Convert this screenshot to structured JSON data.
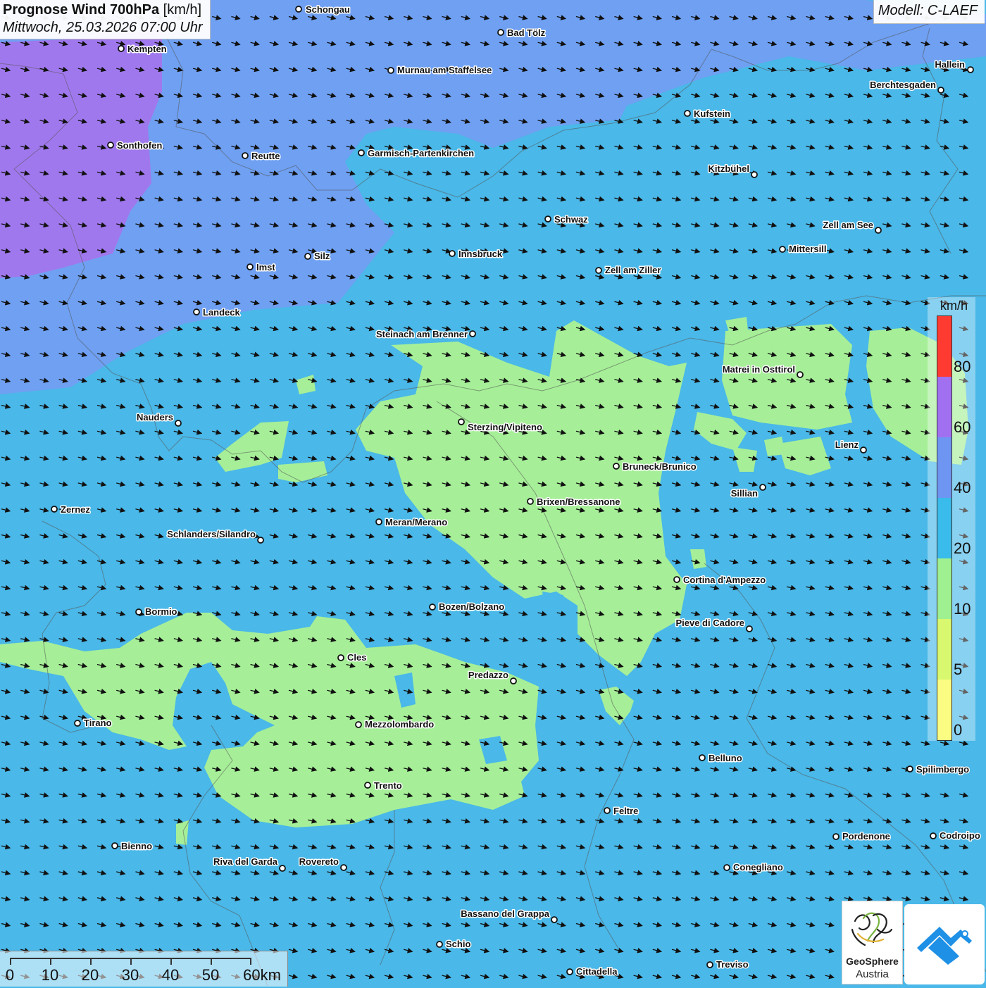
{
  "header": {
    "title_bold": "Prognose Wind 700hPa",
    "title_unit": "[km/h]",
    "subtitle": "Mittwoch, 25.03.2026 07:00 Uhr",
    "model": "Modell: C-LAEF"
  },
  "legend": {
    "unit": "km/h",
    "ticks": [
      "80",
      "60",
      "40",
      "20",
      "10",
      "5",
      "0"
    ],
    "colors": [
      "#ff3a30",
      "#a070f0",
      "#6f95f2",
      "#39bbeb",
      "#9ef090",
      "#d8f870",
      "#fbfc82"
    ]
  },
  "scalebar": {
    "labels": [
      "0",
      "10",
      "20",
      "30",
      "40",
      "50",
      "60km"
    ]
  },
  "logos": {
    "geosphere_name": "GeoSphere",
    "geosphere_sub": "Austria"
  },
  "map": {
    "field_colors": {
      "purple": "#a078ee",
      "blue": "#6fa0f2",
      "cyan": "#4ab8e8",
      "green": "#a6ef98"
    },
    "wind_direction": "west-northwest",
    "cities": [
      "Schongau",
      "Bad Tölz",
      "Kempten",
      "Murnau am Staffelsee",
      "Hallein",
      "Berchtesgaden",
      "Kufstein",
      "Sonthofen",
      "Reutte",
      "Garmisch-Partenkirchen",
      "Kitzbühel",
      "Schwaz",
      "Zell am See",
      "Mittersill",
      "Imst",
      "Silz",
      "Innsbruck",
      "Zell am Ziller",
      "Landeck",
      "Steinach am Brenner",
      "Matrei in Osttirol",
      "Nauders",
      "Sterzing/Vipiteno",
      "Lienz",
      "Bruneck/Brunico",
      "Sillian",
      "Brixen/Bressanone",
      "Zernez",
      "Meran/Merano",
      "Schlanders/Silandro",
      "Cortina d'Ampezzo",
      "Bozen/Bolzano",
      "Bormio",
      "Pieve di Cadore",
      "Cles",
      "Predazzo",
      "Tirano",
      "Mezzolombardo",
      "Belluno",
      "Spilimbergo",
      "Trento",
      "Feltre",
      "Bienno",
      "Pordenone",
      "Codroipo",
      "Riva del Garda",
      "Rovereto",
      "Conegliano",
      "Bassano del Grappa",
      "Schio",
      "Treviso",
      "Cittadella"
    ]
  }
}
